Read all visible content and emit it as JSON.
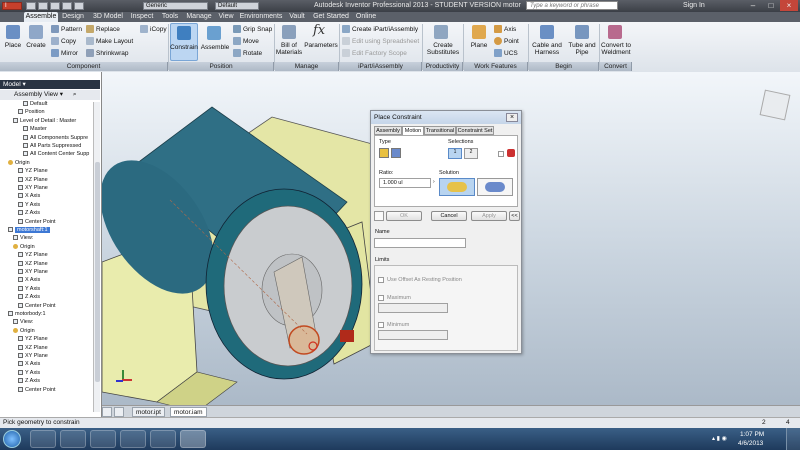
{
  "titlebar": {
    "app_title": "Autodesk Inventor Professional 2013 - STUDENT VERSION   motor",
    "style_dropdown": "Generic",
    "appearance_dropdown": "Default",
    "search_placeholder": "Type a keyword or phrase",
    "signin": "Sign In"
  },
  "ribbon_tabs": [
    "Assemble",
    "Design",
    "3D Model",
    "Inspect",
    "Tools",
    "Manage",
    "View",
    "Environments",
    "Vault",
    "Get Started",
    "Online"
  ],
  "ribbon": {
    "place": "Place",
    "create": "Create",
    "pattern": "Pattern",
    "copy": "Copy",
    "mirror": "Mirror",
    "replace": "Replace",
    "make_layout": "Make Layout",
    "shrinkwrap": "Shrinkwrap",
    "icopy": "iCopy",
    "constrain": "Constrain",
    "assemble": "Assemble",
    "grip_snap": "Grip Snap",
    "move": "Move",
    "rotate": "Rotate",
    "bill_line1": "Bill of",
    "bill_line2": "Materials",
    "parameters": "Parameters",
    "create_ipart": "Create iPart/iAssembly",
    "edit_spreadsheet": "Edit using Spreadsheet",
    "edit_factory": "Edit Factory Scope",
    "create_sub_line1": "Create",
    "create_sub_line2": "Substitutes",
    "plane": "Plane",
    "axis": "Axis",
    "point": "Point",
    "ucs": "UCS",
    "cable_line1": "Cable and",
    "cable_line2": "Harness",
    "tube_line1": "Tube and",
    "tube_line2": "Pipe",
    "convert_line1": "Convert to",
    "convert_line2": "Weldment",
    "groups": [
      "Component",
      "Position",
      "Manage",
      "iPart/iAssembly",
      "Productivity",
      "Work Features",
      "Begin",
      "Convert"
    ]
  },
  "browser": {
    "header": "Model",
    "view": "Assembly View",
    "tree": [
      {
        "label": "Default",
        "icon": "box",
        "indent": 4
      },
      {
        "label": "Position",
        "icon": "box",
        "indent": 3
      },
      {
        "label": "Level of Detail : Master",
        "icon": "box",
        "indent": 2
      },
      {
        "label": "Master",
        "icon": "box",
        "indent": 4
      },
      {
        "label": "All Components Suppre",
        "icon": "box",
        "indent": 4
      },
      {
        "label": "All Parts Suppressed",
        "icon": "box",
        "indent": 4
      },
      {
        "label": "All Content Center Supp",
        "icon": "box",
        "indent": 4
      },
      {
        "label": "Origin",
        "icon": "folder",
        "indent": 1
      },
      {
        "label": "YZ Plane",
        "icon": "box",
        "indent": 3
      },
      {
        "label": "XZ Plane",
        "icon": "box",
        "indent": 3
      },
      {
        "label": "XY Plane",
        "icon": "box",
        "indent": 3
      },
      {
        "label": "X Axis",
        "icon": "box",
        "indent": 3
      },
      {
        "label": "Y Axis",
        "icon": "box",
        "indent": 3
      },
      {
        "label": "Z Axis",
        "icon": "box",
        "indent": 3
      },
      {
        "label": "Center Point",
        "icon": "box",
        "indent": 3
      },
      {
        "label": "motorshaft:1",
        "icon": "part",
        "indent": 1,
        "selected": true
      },
      {
        "label": "View:",
        "icon": "box",
        "indent": 2
      },
      {
        "label": "Origin",
        "icon": "folder",
        "indent": 2
      },
      {
        "label": "YZ Plane",
        "icon": "box",
        "indent": 3
      },
      {
        "label": "XZ Plane",
        "icon": "box",
        "indent": 3
      },
      {
        "label": "XY Plane",
        "icon": "box",
        "indent": 3
      },
      {
        "label": "X Axis",
        "icon": "box",
        "indent": 3
      },
      {
        "label": "Y Axis",
        "icon": "box",
        "indent": 3
      },
      {
        "label": "Z Axis",
        "icon": "box",
        "indent": 3
      },
      {
        "label": "Center Point",
        "icon": "box",
        "indent": 3
      },
      {
        "label": "motorbody:1",
        "icon": "part",
        "indent": 1
      },
      {
        "label": "View:",
        "icon": "box",
        "indent": 2
      },
      {
        "label": "Origin",
        "icon": "folder",
        "indent": 2
      },
      {
        "label": "YZ Plane",
        "icon": "box",
        "indent": 3
      },
      {
        "label": "XZ Plane",
        "icon": "box",
        "indent": 3
      },
      {
        "label": "XY Plane",
        "icon": "box",
        "indent": 3
      },
      {
        "label": "X Axis",
        "icon": "box",
        "indent": 3
      },
      {
        "label": "Y Axis",
        "icon": "box",
        "indent": 3
      },
      {
        "label": "Z Axis",
        "icon": "box",
        "indent": 3
      },
      {
        "label": "Center Point",
        "icon": "box",
        "indent": 3
      }
    ]
  },
  "dialog": {
    "title": "Place Constraint",
    "tabs": [
      "Assembly",
      "Motion",
      "Transitional",
      "Constraint Set"
    ],
    "type_label": "Type",
    "selections_label": "Selections",
    "ratio_label": "Ratio:",
    "ratio_value": "1.000 ul",
    "solution_label": "Solution",
    "ok": "OK",
    "cancel": "Cancel",
    "apply": "Apply",
    "more": "<<",
    "name_label": "Name",
    "limits_tab": "Limits",
    "use_offset": "Use Offset As Resting Position",
    "maximum": "Maximum",
    "minimum": "Minimum"
  },
  "doc_tabs": [
    "motor.ipt",
    "motor.iam"
  ],
  "status": {
    "text": "Pick geometry to constrain",
    "n1": "2",
    "n2": "4"
  },
  "clock": {
    "time": "1:07 PM",
    "date": "4/6/2013"
  }
}
